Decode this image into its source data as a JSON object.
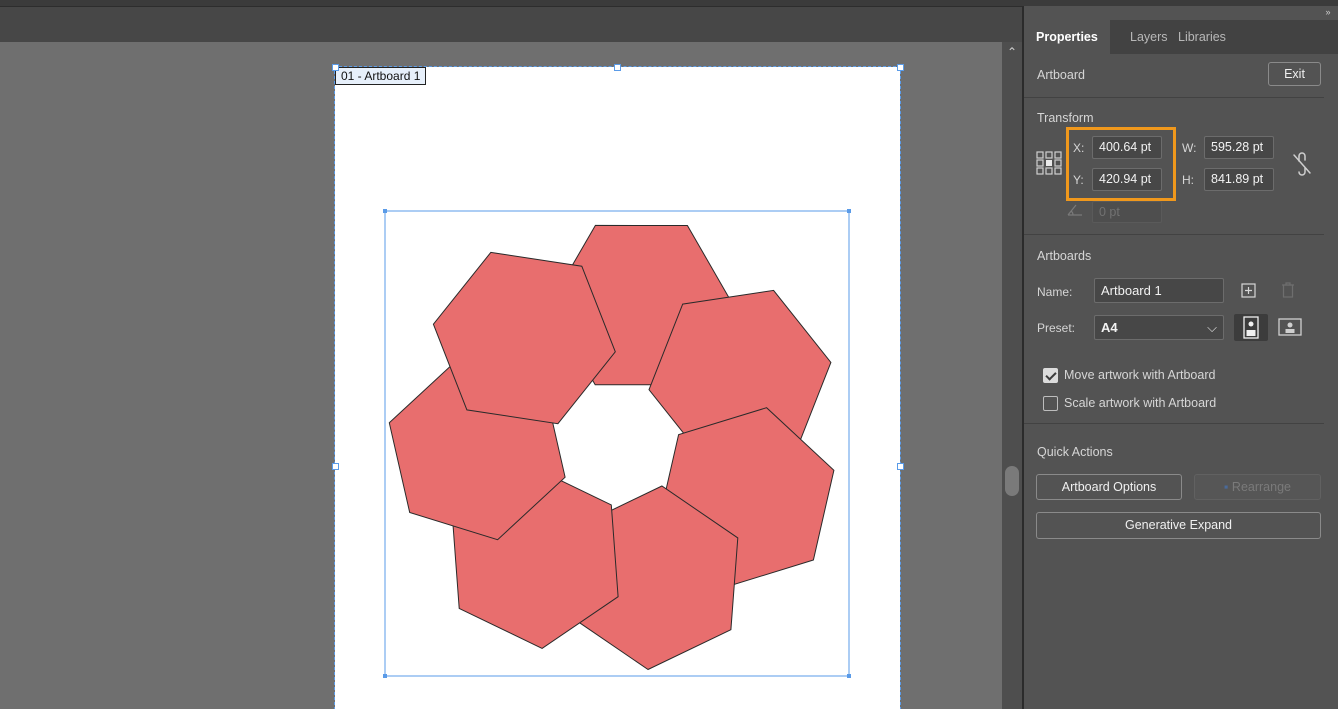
{
  "artboard": {
    "label": "01 - Artboard 1"
  },
  "panel": {
    "tabs": [
      {
        "label": "Properties",
        "active": true
      },
      {
        "label": "Layers",
        "active": false
      },
      {
        "label": "Libraries",
        "active": false
      }
    ],
    "section_title": "Artboard",
    "exit_label": "Exit",
    "transform": {
      "title": "Transform",
      "x_label": "X:",
      "x_value": "400.64 pt",
      "y_label": "Y:",
      "y_value": "420.94 pt",
      "w_label": "W:",
      "w_value": "595.28 pt",
      "h_label": "H:",
      "h_value": "841.89 pt",
      "rotate_value": "0 pt"
    },
    "artboards": {
      "title": "Artboards",
      "name_label": "Name:",
      "name_value": "Artboard 1",
      "preset_label": "Preset:",
      "preset_value": "A4",
      "move_artwork_label": "Move artwork with Artboard",
      "move_artwork_checked": true,
      "scale_artwork_label": "Scale artwork with Artboard",
      "scale_artwork_checked": false
    },
    "quick_actions": {
      "title": "Quick Actions",
      "artboard_options_label": "Artboard Options",
      "rearrange_label": "Rearrange",
      "generative_expand_label": "Generative Expand"
    }
  },
  "colors": {
    "shape_fill": "#e86e6e",
    "shape_stroke": "#2a2a2a",
    "selection": "#5a9be8",
    "highlight": "#f0981c"
  }
}
